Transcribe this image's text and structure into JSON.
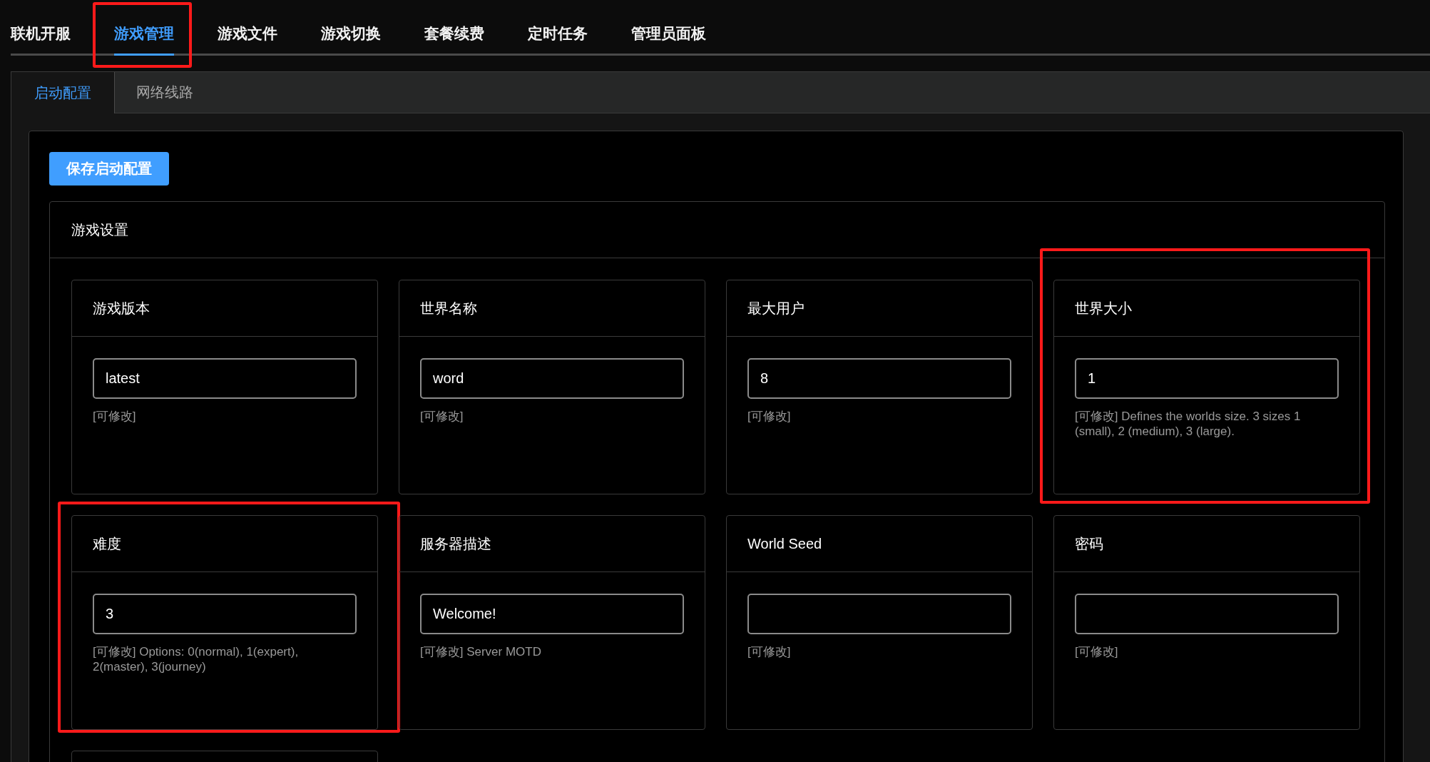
{
  "nav_tabs": [
    {
      "label": "联机开服",
      "selected": false,
      "highlighted": false
    },
    {
      "label": "游戏管理",
      "selected": true,
      "highlighted": true
    },
    {
      "label": "游戏文件",
      "selected": false,
      "highlighted": false
    },
    {
      "label": "游戏切换",
      "selected": false,
      "highlighted": false
    },
    {
      "label": "套餐续费",
      "selected": false,
      "highlighted": false
    },
    {
      "label": "定时任务",
      "selected": false,
      "highlighted": false
    },
    {
      "label": "管理员面板",
      "selected": false,
      "highlighted": false
    }
  ],
  "sub_tabs": [
    {
      "label": "启动配置",
      "selected": true
    },
    {
      "label": "网络线路",
      "selected": false
    }
  ],
  "save_button": "保存启动配置",
  "settings": {
    "title": "游戏设置",
    "fields": [
      {
        "label": "游戏版本",
        "value": "latest",
        "help": "[可修改]",
        "highlighted": false
      },
      {
        "label": "世界名称",
        "value": "word",
        "help": "[可修改]",
        "highlighted": false
      },
      {
        "label": "最大用户",
        "value": "8",
        "help": "[可修改]",
        "highlighted": false
      },
      {
        "label": "世界大小",
        "value": "1",
        "help": "[可修改] Defines the worlds size. 3 sizes 1 (small), 2 (medium), 3 (large).",
        "highlighted": true
      },
      {
        "label": "难度",
        "value": "3",
        "help": "[可修改] Options: 0(normal), 1(expert), 2(master), 3(journey)",
        "highlighted": true
      },
      {
        "label": "服务器描述",
        "value": "Welcome!",
        "help": "[可修改] Server MOTD",
        "highlighted": false
      },
      {
        "label": "World Seed",
        "help": "[可修改]",
        "highlighted": false
      },
      {
        "label": "密码",
        "help": "[可修改]",
        "highlighted": false
      }
    ]
  }
}
